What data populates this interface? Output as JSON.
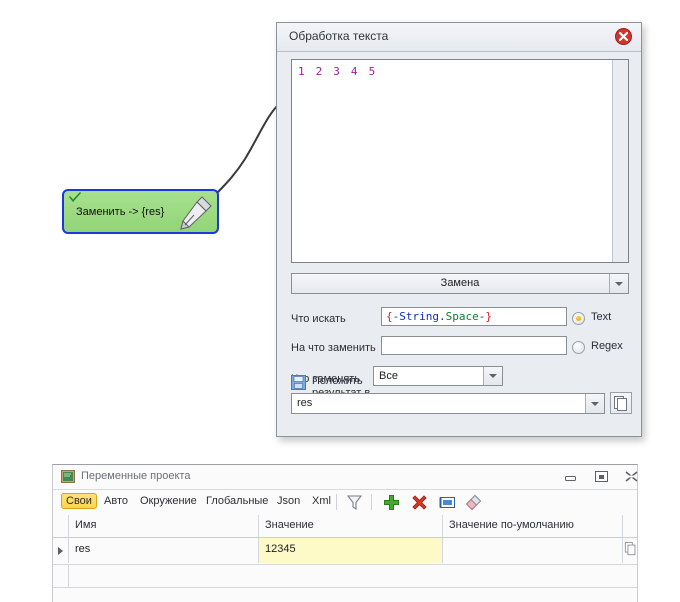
{
  "node": {
    "label": "Заменить -> {res}",
    "check_icon": "green-check-icon",
    "pen_icon": "quill-pen-icon",
    "border_color": "#1b37e0",
    "fill_color": "#9ddb82"
  },
  "dialog": {
    "title": "Обработка текста",
    "close_icon": "close-circle-icon",
    "textarea": {
      "value": "1 2 3 4 5",
      "text_color": "#9c1d9c"
    },
    "mode_combo": {
      "value": "Замена",
      "arrow_icon": "chevron-down-icon"
    },
    "fields": {
      "search_label": "Что искать",
      "search_value": "{-String.Space-}",
      "search_tokens": [
        {
          "t": "{",
          "c": "#d02020"
        },
        {
          "t": "-",
          "c": "#1030c0"
        },
        {
          "t": "String",
          "c": "#1030c0"
        },
        {
          "t": ".",
          "c": "#1030c0"
        },
        {
          "t": "Space",
          "c": "#108030"
        },
        {
          "t": "-",
          "c": "#1030c0"
        },
        {
          "t": "}",
          "c": "#d02020"
        }
      ],
      "replace_label": "На что заменить",
      "replace_value": "",
      "what_label": "Что заменять",
      "what_value": "Все"
    },
    "radios": [
      {
        "label": "Text",
        "selected": true
      },
      {
        "label": "Regex",
        "selected": false
      }
    ],
    "result": {
      "checkbox_icon": "floppy-save-icon",
      "checkbox_label": "Положить результат в переменную:",
      "variable_value": "res",
      "arrow_icon": "chevron-down-icon",
      "copy_icon": "copy-pages-icon"
    }
  },
  "panel": {
    "icon": "chalkboard-icon",
    "title": "Переменные проекта",
    "window_buttons": [
      {
        "name": "minimize-icon"
      },
      {
        "name": "restore-icon"
      },
      {
        "name": "close-icon"
      }
    ],
    "tabs": [
      {
        "label": "Свои",
        "selected": true
      },
      {
        "label": "Авто",
        "selected": false
      },
      {
        "label": "Окружение",
        "selected": false
      },
      {
        "label": "Глобальные",
        "selected": false
      },
      {
        "label": "Json",
        "selected": false
      },
      {
        "label": "Xml",
        "selected": false
      }
    ],
    "tool_icons": [
      {
        "name": "filter-funnel-icon"
      },
      {
        "name": "add-plus-icon"
      },
      {
        "name": "delete-cross-icon"
      },
      {
        "name": "rename-icon"
      },
      {
        "name": "eraser-icon"
      }
    ],
    "table": {
      "columns": [
        "Имя",
        "Значение",
        "Значение по-умолчанию"
      ],
      "rows": [
        {
          "name": "res",
          "value": "12345",
          "default": "",
          "selected": true,
          "copy_icon": "copy-pages-icon"
        }
      ]
    }
  }
}
